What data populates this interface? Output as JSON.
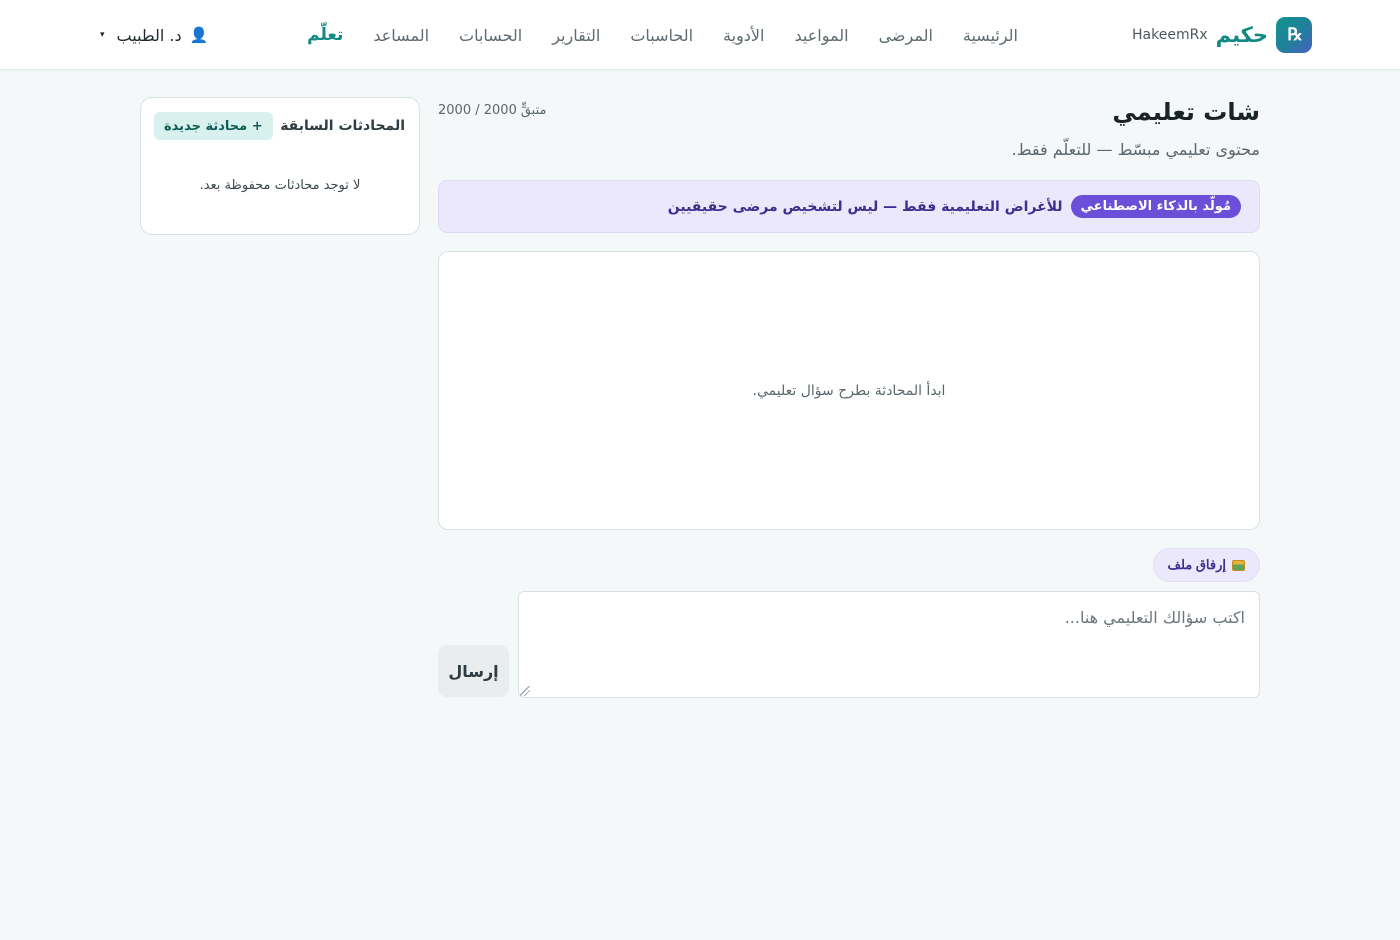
{
  "brand": {
    "logo_glyph": "℞",
    "name_ar": "حكيم",
    "name_en": "HakeemRx"
  },
  "nav": {
    "items": [
      {
        "label": "الرئيسية",
        "active": false
      },
      {
        "label": "المرضى",
        "active": false
      },
      {
        "label": "المواعيد",
        "active": false
      },
      {
        "label": "الأدوية",
        "active": false
      },
      {
        "label": "الحاسبات",
        "active": false
      },
      {
        "label": "التقارير",
        "active": false
      },
      {
        "label": "الحسابات",
        "active": false
      },
      {
        "label": "المساعد",
        "active": false
      },
      {
        "label": "تعلّم",
        "active": true
      }
    ]
  },
  "user": {
    "name": "د. الطبيب",
    "icon": "user-icon",
    "caret": "▾"
  },
  "page": {
    "title": "شات تعليمي",
    "subtitle": "محتوى تعليمي مبسّط — للتعلّم فقط.",
    "remaining_label": "متبقٍّ",
    "remaining_value": "2000 / 2000"
  },
  "notice": {
    "badge": "مُولّد بالذكاء الاصطناعي",
    "text": "للأغراض التعليمية فقط — ليس لتشخيص مرضى حقيقيين"
  },
  "chat": {
    "empty_message": "ابدأ المحادثة بطرح سؤال تعليمي."
  },
  "composer": {
    "attach_label": "إرفاق ملف",
    "attach_icon": "image-icon",
    "placeholder": "اكتب سؤالك التعليمي هنا...",
    "value": "",
    "send_label": "إرسال"
  },
  "history": {
    "title": "المحادثات السابقة",
    "new_chat_label": "+ محادثة جديدة",
    "empty_message": "لا توجد محادثات محفوظة بعد."
  },
  "colors": {
    "brand_teal": "#128a84",
    "ai_purple": "#6b4fd8",
    "notice_bg": "#ece8fb",
    "page_bg": "#f5f8f9"
  }
}
